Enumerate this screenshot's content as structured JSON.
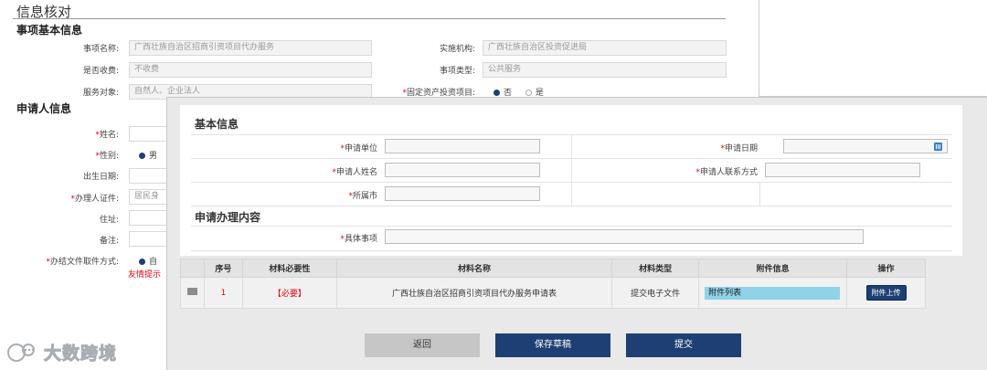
{
  "background": {
    "title": "信息核对",
    "section_basic": "事项基本信息",
    "section_applicant": "申请人信息",
    "fields": {
      "item_name_label": "事项名称:",
      "item_name_value": "广西壮族自治区招商引资项目代办服务",
      "agency_label": "实施机构:",
      "agency_value": "广西壮族自治区投资促进局",
      "fee_label": "是否收费:",
      "fee_value": "不收费",
      "type_label": "事项类型:",
      "type_value": "公共服务",
      "target_label": "服务对象:",
      "target_value": "自然人、企业法人",
      "fixed_asset_label": "固定资产投资项目:",
      "fixed_asset_no": "否",
      "fixed_asset_yes": "是"
    },
    "applicant": {
      "name_label": "姓名:",
      "gender_label": "性别:",
      "gender_value": "男",
      "birth_label": "出生日期:",
      "id_label": "办理人证件:",
      "id_value": "居民身",
      "address_label": "住址:",
      "note_label": "备注:",
      "pickup_label": "办结文件取件方式:",
      "pickup_value": "自",
      "warning": "友情提示"
    }
  },
  "watermark": "大数跨境",
  "modal": {
    "section_basic": "基本信息",
    "section_content": "申请办理内容",
    "fields": {
      "unit_label": "申请单位",
      "date_label": "申请日期",
      "applicant_name_label": "申请人姓名",
      "contact_label": "申请人联系方式",
      "city_label": "所属市",
      "detail_label": "具体事项"
    },
    "table": {
      "headers": [
        "序号",
        "材料必要性",
        "材料名称",
        "材料类型",
        "附件信息",
        "操作"
      ],
      "rows": [
        {
          "index": "1",
          "necessity": "【必要】",
          "name": "广西壮族自治区招商引资项目代办服务申请表",
          "type": "提交电子文件",
          "attachment": "附件列表",
          "action": "附件上传"
        }
      ]
    },
    "buttons": {
      "back": "返回",
      "save": "保存草稿",
      "submit": "提交"
    }
  }
}
